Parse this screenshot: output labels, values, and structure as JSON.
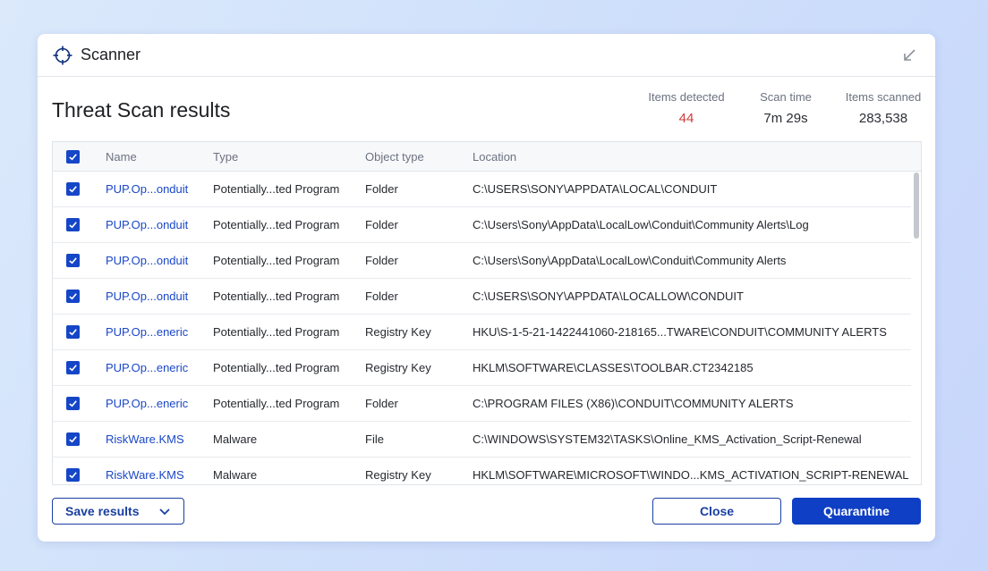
{
  "window": {
    "title": "Scanner"
  },
  "results": {
    "heading": "Threat Scan results",
    "stats": {
      "detected_label": "Items detected",
      "detected_value": "44",
      "time_label": "Scan time",
      "time_value": "7m 29s",
      "scanned_label": "Items scanned",
      "scanned_value": "283,538"
    }
  },
  "table": {
    "headers": {
      "name": "Name",
      "type": "Type",
      "object_type": "Object type",
      "location": "Location"
    },
    "rows": [
      {
        "name": "PUP.Op...onduit",
        "type": "Potentially...ted Program",
        "object_type": "Folder",
        "location": "C:\\USERS\\SONY\\APPDATA\\LOCAL\\CONDUIT",
        "checked": true
      },
      {
        "name": "PUP.Op...onduit",
        "type": "Potentially...ted Program",
        "object_type": "Folder",
        "location": "C:\\Users\\Sony\\AppData\\LocalLow\\Conduit\\Community Alerts\\Log",
        "checked": true
      },
      {
        "name": "PUP.Op...onduit",
        "type": "Potentially...ted Program",
        "object_type": "Folder",
        "location": "C:\\Users\\Sony\\AppData\\LocalLow\\Conduit\\Community Alerts",
        "checked": true
      },
      {
        "name": "PUP.Op...onduit",
        "type": "Potentially...ted Program",
        "object_type": "Folder",
        "location": "C:\\USERS\\SONY\\APPDATA\\LOCALLOW\\CONDUIT",
        "checked": true
      },
      {
        "name": "PUP.Op...eneric",
        "type": "Potentially...ted Program",
        "object_type": "Registry Key",
        "location": "HKU\\S-1-5-21-1422441060-218165...TWARE\\CONDUIT\\COMMUNITY ALERTS",
        "checked": true
      },
      {
        "name": "PUP.Op...eneric",
        "type": "Potentially...ted Program",
        "object_type": "Registry Key",
        "location": "HKLM\\SOFTWARE\\CLASSES\\TOOLBAR.CT2342185",
        "checked": true
      },
      {
        "name": "PUP.Op...eneric",
        "type": "Potentially...ted Program",
        "object_type": "Folder",
        "location": "C:\\PROGRAM FILES (X86)\\CONDUIT\\COMMUNITY ALERTS",
        "checked": true
      },
      {
        "name": "RiskWare.KMS",
        "type": "Malware",
        "object_type": "File",
        "location": "C:\\WINDOWS\\SYSTEM32\\TASKS\\Online_KMS_Activation_Script-Renewal",
        "checked": true
      },
      {
        "name": "RiskWare.KMS",
        "type": "Malware",
        "object_type": "Registry Key",
        "location": "HKLM\\SOFTWARE\\MICROSOFT\\WINDO...KMS_ACTIVATION_SCRIPT-RENEWAL",
        "checked": true
      }
    ]
  },
  "footer": {
    "save_label": "Save results",
    "close_label": "Close",
    "quarantine_label": "Quarantine"
  },
  "colors": {
    "accent": "#0f3fc4",
    "link": "#1a47c7",
    "danger": "#d23a3a"
  },
  "icons": {
    "app": "crosshair-icon",
    "minimize": "minimize-arrow-icon",
    "dropdown": "chevron-down-icon",
    "checkbox": "check-icon"
  }
}
